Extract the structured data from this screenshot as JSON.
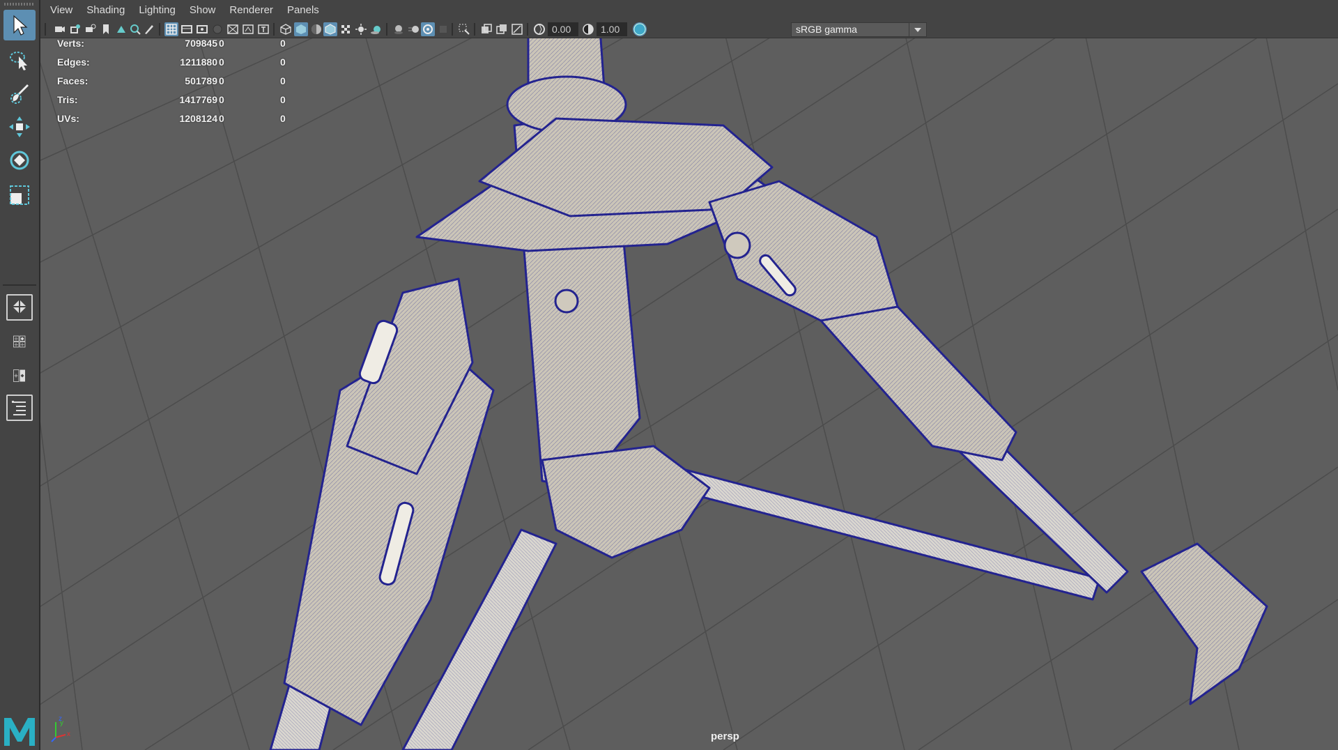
{
  "menu": [
    "View",
    "Shading",
    "Lighting",
    "Show",
    "Renderer",
    "Panels"
  ],
  "icon_bar": {
    "exposure_value": "0.00",
    "gamma_value": "1.00",
    "color_space": "sRGB gamma",
    "color_mgmt_badge": "ON"
  },
  "hud": {
    "rows": [
      {
        "label": "Verts:",
        "v1": "709845",
        "v2": "0",
        "v3": "0"
      },
      {
        "label": "Edges:",
        "v1": "1211880",
        "v2": "0",
        "v3": "0"
      },
      {
        "label": "Faces:",
        "v1": "501789",
        "v2": "0",
        "v3": "0"
      },
      {
        "label": "Tris:",
        "v1": "1417769",
        "v2": "0",
        "v3": "0"
      },
      {
        "label": "UVs:",
        "v1": "1208124",
        "v2": "0",
        "v3": "0"
      }
    ]
  },
  "viewport": {
    "camera": "persp"
  },
  "axis_gizmo": {
    "x": "x",
    "y": "y",
    "z": "z"
  },
  "colors": {
    "active_blue": "#5d8fb3",
    "wire_blue": "#2a2aa0",
    "model_fill": "#c9c3b6",
    "grid_bg": "#5e5e5e"
  },
  "tools": [
    "select-tool",
    "lasso-tool",
    "paint-select-tool",
    "move-tool",
    "rotate-tool",
    "scale-tool"
  ]
}
